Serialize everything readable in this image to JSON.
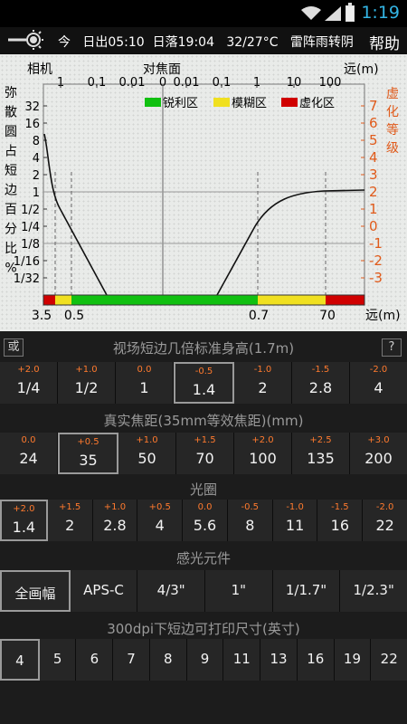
{
  "status_bar": {
    "time": "1:19"
  },
  "header": {
    "today": "今",
    "sunrise": "日出05:10",
    "sunset": "日落19:04",
    "temperature": "32/27°C",
    "weather": "雷阵雨转阴",
    "help": "帮助"
  },
  "chart": {
    "top_left_label": "相机",
    "top_center_label": "对焦面",
    "top_right_label": "远(m)",
    "top_ticks": [
      "1",
      "0.1",
      "0.01",
      "0",
      "0.01",
      "0.1",
      "1",
      "10",
      "100"
    ],
    "left_axis_title": [
      "弥",
      "散",
      "圆",
      "占",
      "短",
      "边",
      "百",
      "分",
      "比",
      "%"
    ],
    "left_ticks": [
      "32",
      "16",
      "8",
      "4",
      "2",
      "1",
      "1/2",
      "1/4",
      "1/8",
      "1/16",
      "1/32"
    ],
    "right_axis_title": [
      "虚",
      "化",
      "等",
      "级"
    ],
    "right_ticks": [
      "7",
      "6",
      "5",
      "4",
      "3",
      "2",
      "1",
      "0",
      "-1",
      "-2",
      "-3"
    ],
    "legend": [
      {
        "label": "锐利区",
        "color": "#10c010"
      },
      {
        "label": "模糊区",
        "color": "#f0e020"
      },
      {
        "label": "虚化区",
        "color": "#d00000"
      }
    ],
    "bottom_labels": [
      "3.5",
      "0.5",
      "0.7",
      "70",
      "远(m)"
    ],
    "colors": {
      "sharp": "#10c010",
      "blur": "#f0e020",
      "bokeh": "#d00000",
      "right_axis": "#e05a1a"
    }
  },
  "sections": {
    "fov": {
      "title": "视场短边几倍标准身高(1.7m)",
      "left_button": "或",
      "right_button": "?",
      "items": [
        {
          "delta": "+2.0",
          "value": "1/4"
        },
        {
          "delta": "+1.0",
          "value": "1/2"
        },
        {
          "delta": "0.0",
          "value": "1"
        },
        {
          "delta": "-0.5",
          "value": "1.4"
        },
        {
          "delta": "-1.0",
          "value": "2"
        },
        {
          "delta": "-1.5",
          "value": "2.8"
        },
        {
          "delta": "-2.0",
          "value": "4"
        }
      ],
      "selected": "1.4"
    },
    "focal": {
      "title": "真实焦距(35mm等效焦距)(mm)",
      "items": [
        {
          "delta": "0.0",
          "value": "24"
        },
        {
          "delta": "+0.5",
          "value": "35"
        },
        {
          "delta": "+1.0",
          "value": "50"
        },
        {
          "delta": "+1.5",
          "value": "70"
        },
        {
          "delta": "+2.0",
          "value": "100"
        },
        {
          "delta": "+2.5",
          "value": "135"
        },
        {
          "delta": "+3.0",
          "value": "200"
        }
      ],
      "selected": "35"
    },
    "aperture": {
      "title": "光圈",
      "items": [
        {
          "delta": "+2.0",
          "value": "1.4"
        },
        {
          "delta": "+1.5",
          "value": "2"
        },
        {
          "delta": "+1.0",
          "value": "2.8"
        },
        {
          "delta": "+0.5",
          "value": "4"
        },
        {
          "delta": "0.0",
          "value": "5.6"
        },
        {
          "delta": "-0.5",
          "value": "8"
        },
        {
          "delta": "-1.0",
          "value": "11"
        },
        {
          "delta": "-1.5",
          "value": "16"
        },
        {
          "delta": "-2.0",
          "value": "22"
        }
      ],
      "selected": "1.4"
    },
    "sensor": {
      "title": "感光元件",
      "items": [
        "全画幅",
        "APS-C",
        "4/3\"",
        "1\"",
        "1/1.7\"",
        "1/2.3\""
      ],
      "selected": "全画幅"
    },
    "print": {
      "title": "300dpi下短边可打印尺寸(英寸)",
      "items": [
        "4",
        "5",
        "6",
        "7",
        "8",
        "9",
        "11",
        "13",
        "16",
        "19",
        "22"
      ],
      "selected": "4"
    }
  }
}
